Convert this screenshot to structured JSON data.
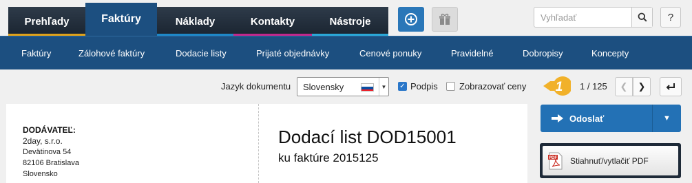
{
  "nav": {
    "tabs": [
      {
        "label": "Prehľady",
        "accent": "#e0a21a"
      },
      {
        "label": "Faktúry",
        "accent": "#1c4f80",
        "active": true
      },
      {
        "label": "Náklady",
        "accent": "#1e88c8"
      },
      {
        "label": "Kontakty",
        "accent": "#c2288c"
      },
      {
        "label": "Nástroje",
        "accent": "#2aa8d8"
      }
    ],
    "plus_icon": "plus-circle-icon",
    "gift_icon": "gift-icon"
  },
  "search": {
    "placeholder": "Vyhľadať"
  },
  "help": {
    "label": "?"
  },
  "subnav": {
    "items": [
      "Faktúry",
      "Zálohové faktúry",
      "Dodacie listy",
      "Prijaté objednávky",
      "Cenové ponuky",
      "Pravidelné",
      "Dobropisy",
      "Koncepty"
    ]
  },
  "toolbar": {
    "language_label": "Jazyk dokumentu",
    "language_value": "Slovensky",
    "signature_label": "Podpis",
    "signature_checked": true,
    "show_prices_label": "Zobrazovať ceny",
    "show_prices_checked": false,
    "badge": "1",
    "pager": "1 / 125"
  },
  "document": {
    "supplier_heading": "DODÁVATEĽ:",
    "supplier_name": "2day, s.r.o.",
    "supplier_lines": [
      "Devätinova 54",
      "82106 Bratislava",
      "Slovensko"
    ],
    "title": "Dodací list DOD15001",
    "subtitle": "ku faktúre 2015125"
  },
  "actions": {
    "send_label": "Odoslať",
    "pdf_label": "Stiahnuť/vytlačiť PDF"
  },
  "colors": {
    "brand_blue": "#1c4f80",
    "button_blue": "#2371b5",
    "badge_yellow": "#f1b12a"
  }
}
